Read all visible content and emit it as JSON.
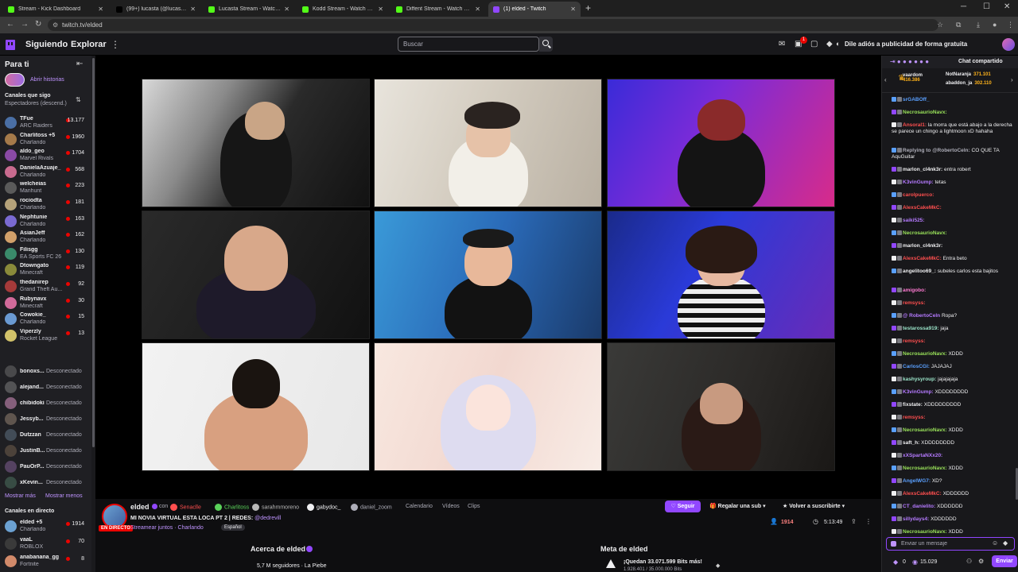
{
  "browser": {
    "tabs": [
      {
        "title": "Stream - Kick Dashboard",
        "color": "#53fc18"
      },
      {
        "title": "(99+) lucasta (@lucastastrike)",
        "color": "#000000"
      },
      {
        "title": "Lucasta Stream - Watch Live on",
        "color": "#53fc18"
      },
      {
        "title": "Kodd Stream - Watch Live on K",
        "color": "#53fc18"
      },
      {
        "title": "Diffent Stream - Watch Live on",
        "color": "#53fc18"
      },
      {
        "title": "(1) elded - Twitch",
        "color": "#9147ff"
      }
    ],
    "url": "twitch.tv/elded"
  },
  "topnav": {
    "following": "Siguiendo",
    "browse": "Explorar",
    "search_placeholder": "Buscar",
    "notif_count": "1",
    "ad_free": "Dile adiós a publicidad de forma gratuita"
  },
  "sidebar": {
    "header": "Para ti",
    "stories": "Abrir historias",
    "followed_title": "Canales que sigo",
    "followed_sub": "Espectadores (descend.)",
    "channels": [
      {
        "name": "TFue",
        "game": "ARC Raiders",
        "viewers": "13.177",
        "color": "#4a6fa5"
      },
      {
        "name": "Charlitoss +5",
        "game": "Charlando",
        "viewers": "1960",
        "color": "#a57a4a"
      },
      {
        "name": "aldo_geo",
        "game": "Marvel Rivals",
        "viewers": "1704",
        "color": "#8a4aa5"
      },
      {
        "name": "DanielaAzuaje_",
        "game": "Charlando",
        "viewers": "568",
        "color": "#c96b8f"
      },
      {
        "name": "welcheias",
        "game": "Manhunt",
        "viewers": "223",
        "color": "#5a5a5a"
      },
      {
        "name": "rociodta",
        "game": "Charlando",
        "viewers": "181",
        "color": "#b5a27a"
      },
      {
        "name": "Nephtunie",
        "game": "Charlando",
        "viewers": "163",
        "color": "#7a6ad2"
      },
      {
        "name": "AsianJeff",
        "game": "Charlando",
        "viewers": "162",
        "color": "#d2a06a"
      },
      {
        "name": "Filisgg",
        "game": "EA Sports FC 26",
        "viewers": "130",
        "color": "#3a8a6a"
      },
      {
        "name": "Dtowngato",
        "game": "Minecraft",
        "viewers": "119",
        "color": "#8a8a3a"
      },
      {
        "name": "thedanirep",
        "game": "Grand Theft Au...",
        "viewers": "92",
        "color": "#a53a3a"
      },
      {
        "name": "Rubynavx",
        "game": "Minecraft",
        "viewers": "30",
        "color": "#d26a9a"
      },
      {
        "name": "Cowokie_",
        "game": "Charlando",
        "viewers": "15",
        "color": "#6a9ad2"
      },
      {
        "name": "Viperzly",
        "game": "Rocket League",
        "viewers": "13",
        "color": "#d2c26a"
      }
    ],
    "offline": [
      {
        "name": "bonoxs...",
        "status": "Desconectado",
        "color": "#666666"
      },
      {
        "name": "alejand...",
        "status": "Desconectado",
        "color": "#777777"
      },
      {
        "name": "chibidoki",
        "status": "Desconectado",
        "color": "#c98ab5"
      },
      {
        "name": "Jessyb...",
        "status": "Desconectado",
        "color": "#8a7a6a"
      },
      {
        "name": "Dutzzan",
        "status": "Desconectado",
        "color": "#5a6a7a"
      },
      {
        "name": "JustinB...",
        "status": "Desconectado",
        "color": "#6a5a4a"
      },
      {
        "name": "PauOrP...",
        "status": "Desconectado",
        "color": "#7a5a8a"
      },
      {
        "name": "xKevin...",
        "status": "Desconectado",
        "color": "#4a6a5a"
      }
    ],
    "show_more": "Mostrar más",
    "show_less": "Mostrar menos",
    "live_title": "Canales en directo",
    "live_channels": [
      {
        "name": "elded +5",
        "game": "Charlando",
        "viewers": "1914",
        "color": "#6ba1d2"
      },
      {
        "name": "vaaL",
        "game": "ROBLOX",
        "viewers": "70",
        "color": "#3a3a3a"
      },
      {
        "name": "anabanana_gg",
        "game": "Fortnite",
        "viewers": "8",
        "color": "#d28a6a"
      }
    ]
  },
  "info": {
    "live_badge": "EN DIRECTO",
    "channel": "elded",
    "with": "con",
    "collabs": [
      {
        "name": "Senaclle",
        "color": "#ff4f4f"
      },
      {
        "name": "Charlitoss",
        "color": "#5ad25a"
      },
      {
        "name": "sarahmmoreno",
        "color": "#b8b8b8"
      },
      {
        "name": "gabydoc_",
        "color": "#efeff1"
      },
      {
        "name": "daniel_zoom",
        "color": "#adadb8"
      }
    ],
    "tabs": [
      "Calendario",
      "Vídeos",
      "Clips"
    ],
    "title": "MI NOVIA VIRTUAL ESTA LOCA PT 2 | REDES:",
    "title_handle": "@dedrevill",
    "meta": "Streamear juntos · Charlando",
    "language": "Español",
    "follow": "Seguir",
    "gift": "Regalar una sub",
    "resub": "Volver a suscribirte",
    "viewers": "1914",
    "uptime": "5:13:49",
    "about": "Acerca de elded",
    "followers": "5,7 M seguidores · La Piebe",
    "goal_title": "Meta de elded",
    "goal_text": "¡Quedan 33.071.599 Bits más!",
    "goal_sub": "1.928.401 / 35.000.000 Bits"
  },
  "chat": {
    "title": "Chat compartido",
    "leader": [
      {
        "name": "vaardom",
        "score": "416.386"
      },
      {
        "name": "NotNaranja",
        "score": "371.101"
      },
      {
        "name": "abaddon_ja",
        "score": "302.110"
      }
    ],
    "messages": [
      {
        "user": "srGABOff_",
        "text": "",
        "color": "#5aa0ff"
      },
      {
        "user": "NecrosaurioNavx:",
        "text": "",
        "color": "#9ae35a"
      },
      {
        "user": "Ansoral1:",
        "text": "la morra que está abajo a la derecha se parece un chingo a lightmoon xD hahaha",
        "color": "#ff4f4f"
      },
      {
        "user": "Replying to @RobertoCeln:",
        "text": "CO QUE TA AquGuitar",
        "color": "#adadb8"
      },
      {
        "user": "marlon_cl4nk3r:",
        "text": "entra robert",
        "color": "#efeff1"
      },
      {
        "user": "K3vinGump:",
        "text": "tetas",
        "color": "#b57aff"
      },
      {
        "user": "carolpuerco:",
        "text": "",
        "color": "#ff4f4f"
      },
      {
        "user": "AlexsCakeMkC:",
        "text": "",
        "color": "#ff4f4f"
      },
      {
        "user": "saiki525:",
        "text": "",
        "color": "#b57aff"
      },
      {
        "user": "NecrosaurioNavx:",
        "text": "",
        "color": "#9ae35a"
      },
      {
        "user": "marlon_cl4nk3r:",
        "text": "",
        "color": "#efeff1"
      },
      {
        "user": "AlexsCakeMkC:",
        "text": "Entra beto",
        "color": "#ff4f4f"
      },
      {
        "user": "angelitoo69_:",
        "text": "subeles carlos esta bajitos",
        "color": "#efeff1"
      },
      {
        "user": "amigobo:",
        "text": "",
        "color": "#ff7ad2"
      },
      {
        "user": "remsyss:",
        "text": "",
        "color": "#ff4f4f"
      },
      {
        "user": "@ RobertoCeln",
        "text": "Ropa?",
        "color": "#b57aff"
      },
      {
        "user": "testarossa919:",
        "text": "jaja",
        "color": "#9ae3c8"
      },
      {
        "user": "remsyss:",
        "text": "",
        "color": "#ff4f4f"
      },
      {
        "user": "NecrosaurioNavx:",
        "text": "XDDD",
        "color": "#9ae35a"
      },
      {
        "user": "CarlosCGI:",
        "text": "JAJAJAJ",
        "color": "#5aa0ff"
      },
      {
        "user": "kashysyroup:",
        "text": "jajajajaja",
        "color": "#9ae3c8"
      },
      {
        "user": "K3vinGump:",
        "text": "XDDDDDDDD",
        "color": "#b57aff"
      },
      {
        "user": "fixstate:",
        "text": "XDDDDDDDDD",
        "color": "#efeff1"
      },
      {
        "user": "remsyss:",
        "text": "",
        "color": "#ff4f4f"
      },
      {
        "user": "NecrosaurioNavx:",
        "text": "XDDD",
        "color": "#9ae35a"
      },
      {
        "user": "saft_h:",
        "text": "XDDDDDDDD",
        "color": "#efeff1"
      },
      {
        "user": "xXSpartaNXx20:",
        "text": "",
        "color": "#b57aff"
      },
      {
        "user": "NecrosaurioNavx:",
        "text": "XDDD",
        "color": "#9ae35a"
      },
      {
        "user": "AngelWG7:",
        "text": "XD?",
        "color": "#5aa0ff"
      },
      {
        "user": "AlexsCakeMkC:",
        "text": "XDDDDDD",
        "color": "#ff4f4f"
      },
      {
        "user": "CT_danielito:",
        "text": "XDDDDDD",
        "color": "#b57aff"
      },
      {
        "user": "sillydays4:",
        "text": "XDDDDDD",
        "color": "#b57aff"
      },
      {
        "user": "NecrosaurioNavx:",
        "text": "XDDD",
        "color": "#9ae35a"
      }
    ],
    "input_placeholder": "Enviar un mensaje",
    "points_zero": "0",
    "points": "15.029",
    "send": "Enviar"
  }
}
